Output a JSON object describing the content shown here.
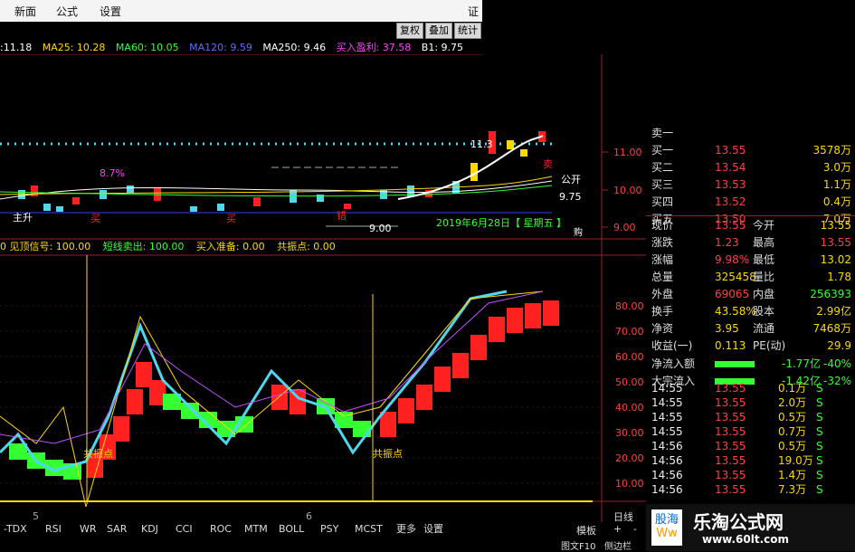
{
  "menu": {
    "items": [
      "新面",
      "公式",
      "设置"
    ],
    "right_label": "证"
  },
  "toolbar": {
    "buttons": [
      "复权",
      "叠加",
      "统计"
    ]
  },
  "ma_row": [
    {
      "text": ":11.18",
      "color": "#ffffff"
    },
    {
      "text": "MA25: 10.28",
      "color": "#ffd800"
    },
    {
      "text": "MA60: 10.05",
      "color": "#33ff33"
    },
    {
      "text": "MA120: 9.59",
      "color": "#5b6bff"
    },
    {
      "text": "MA250: 9.46",
      "color": "#ffffff"
    },
    {
      "text": "买入盈利: 37.58",
      "color": "#ff40ff"
    },
    {
      "text": "B1: 9.75",
      "color": "#ffffff"
    }
  ],
  "price_axis": [
    "11.00",
    "10.00",
    "9.00"
  ],
  "osc_axis": [
    "80.00",
    "70.00",
    "60.00",
    "50.00",
    "40.00",
    "30.00",
    "20.00",
    "10.00"
  ],
  "chart_labels": {
    "pct": "8.7%",
    "high": "11.3",
    "date": "2019年6月28日【 星期五 】",
    "low": "9.00",
    "right_tag1": "9.75",
    "right_tag2": "公开",
    "left_tag": "主升",
    "buy1": "买",
    "buy2": "买",
    "sell": "卖",
    "tag_pin": "购",
    "resonance1": "共振点",
    "resonance2": "共振点",
    "cuo": "错"
  },
  "indicator_row": [
    {
      "text": "0 见顶信号: 100.00",
      "color": "#ffd800"
    },
    {
      "text": "短线卖出: 100.00",
      "color": "#33ff33"
    },
    {
      "text": "买入准备: 0.00",
      "color": "#ffd800"
    },
    {
      "text": "共振点: 0.00",
      "color": "#ffd800"
    }
  ],
  "order_book": [
    {
      "label": "卖一",
      "price": "",
      "vol": ""
    },
    {
      "label": "买一",
      "price": "13.55",
      "vol": "3578万"
    },
    {
      "label": "买二",
      "price": "13.54",
      "vol": "3.0万"
    },
    {
      "label": "买三",
      "price": "13.53",
      "vol": "1.1万"
    },
    {
      "label": "买四",
      "price": "13.52",
      "vol": "0.4万"
    },
    {
      "label": "买五",
      "price": "13.50",
      "vol": "7.0万"
    }
  ],
  "stats": [
    {
      "l1": "现价",
      "v1": "13.55",
      "l2": "今开",
      "v2": "13.55"
    },
    {
      "l1": "涨跌",
      "v1": "1.23",
      "l2": "最高",
      "v2": "13.55"
    },
    {
      "l1": "涨幅",
      "v1": "9.98%",
      "l2": "最低",
      "v2": "13.02"
    },
    {
      "l1": "总量",
      "v1": "325458",
      "l2": "量比",
      "v2": "1.78"
    },
    {
      "l1": "外盘",
      "v1": "69065",
      "l2": "内盘",
      "v2": "256393"
    },
    {
      "l1": "换手",
      "v1": "43.58%",
      "l2": "股本",
      "v2": "2.99亿"
    },
    {
      "l1": "净资",
      "v1": "3.95",
      "l2": "流通",
      "v2": "7468万"
    },
    {
      "l1": "收益(一)",
      "v1": "0.113",
      "l2": "PE(动)",
      "v2": "29.9"
    }
  ],
  "flows": [
    {
      "label": "净流入额",
      "value": "-1.77亿",
      "pct": "-40%"
    },
    {
      "label": "大宗流入",
      "value": "-1.42亿",
      "pct": "-32%"
    }
  ],
  "ticks": [
    {
      "t": "14:55",
      "p": "13.55",
      "v": "0.1万",
      "s": "S"
    },
    {
      "t": "14:55",
      "p": "13.55",
      "v": "2.0万",
      "s": "S"
    },
    {
      "t": "14:55",
      "p": "13.55",
      "v": "0.5万",
      "s": "S"
    },
    {
      "t": "14:55",
      "p": "13.55",
      "v": "0.7万",
      "s": "S"
    },
    {
      "t": "14:56",
      "p": "13.55",
      "v": "0.5万",
      "s": "S"
    },
    {
      "t": "14:56",
      "p": "13.55",
      "v": "19.0万",
      "s": "S"
    },
    {
      "t": "14:56",
      "p": "13.55",
      "v": "1.4万",
      "s": "S"
    },
    {
      "t": "14:56",
      "p": "13.55",
      "v": "7.3万",
      "s": "S"
    }
  ],
  "tabs": [
    "-TDX",
    "RSI",
    "WR",
    "SAR",
    "KDJ",
    "CCI",
    "ROC",
    "MTM",
    "BOLL",
    "PSY",
    "MCST",
    "更多",
    "设置"
  ],
  "bottom_right": {
    "template": "模板",
    "plus": "+",
    "minus": "-",
    "period": "日线",
    "f10": "图文F10",
    "sidebar": "侧边栏"
  },
  "x_markers": [
    "5",
    "6"
  ],
  "brand": {
    "name": "乐淘公式网",
    "url": "www.60lt.com",
    "left_logo": "股海",
    "left_sub": "Ww"
  },
  "colors": {
    "up": "#ff2020",
    "down": "#33ff33",
    "cyan": "#4fd7f0",
    "yellow": "#ffd800",
    "magenta": "#ff40ff"
  }
}
